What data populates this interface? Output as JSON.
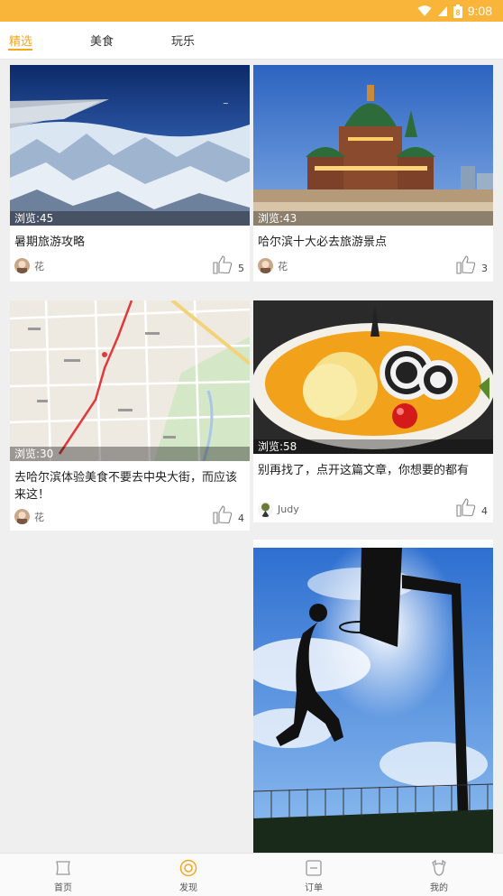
{
  "status_bar": {
    "time": "9:08",
    "battery_level": "8"
  },
  "tabs": [
    {
      "label": "精选",
      "active": true
    },
    {
      "label": "美食",
      "active": false
    },
    {
      "label": "玩乐",
      "active": false
    }
  ],
  "cards": [
    {
      "views": "浏览:45",
      "title": "暑期旅游攻略",
      "author": "花",
      "likes": "5",
      "image": "airplane-wing-over-snowy-mountains"
    },
    {
      "views": "浏览:43",
      "title": "哈尔滨十大必去旅游景点",
      "author": "花",
      "likes": "3",
      "image": "saint-sophia-cathedral-at-dusk"
    },
    {
      "views": "浏览:30",
      "title": "去哈尔滨体验美食不要去中央大街，而应该来这！",
      "author": "花",
      "likes": "4",
      "image": "city-map-with-red-route"
    },
    {
      "views": "浏览:58",
      "title": "别再找了，点开这篇文章，你想要的都有",
      "author": "Judy",
      "likes": "4",
      "image": "dessert-with-pineapple-and-cherry"
    },
    {
      "image": "basketball-dunk-silhouette"
    }
  ],
  "bottom_nav": [
    {
      "label": "首页",
      "icon": "home-icon"
    },
    {
      "label": "发现",
      "icon": "discover-icon",
      "active": true
    },
    {
      "label": "订单",
      "icon": "order-icon"
    },
    {
      "label": "我的",
      "icon": "profile-icon"
    }
  ],
  "colors": {
    "accent": "#f5a623",
    "status_bar": "#f9b53a"
  }
}
